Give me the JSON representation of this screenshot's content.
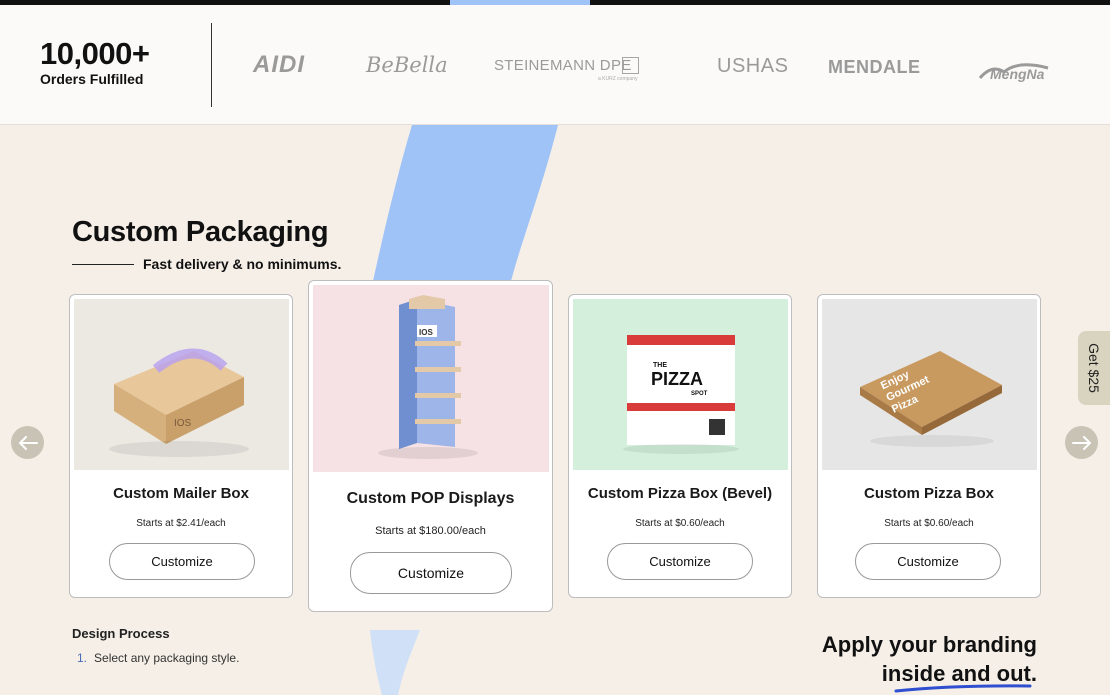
{
  "stats": {
    "number": "10,000+",
    "label": "Orders Fulfilled"
  },
  "brand_logos": [
    "AIDI",
    "BeBella",
    "STEINEMANN DPE",
    "USHAS",
    "MENDALE",
    "MengNa"
  ],
  "brand_logo_sub": "a KURZ company",
  "section": {
    "title": "Custom Packaging",
    "subtitle": "Fast delivery & no minimums."
  },
  "products": [
    {
      "name": "Custom Mailer Box",
      "price": "Starts at $2.41/each",
      "button": "Customize",
      "image_bg": "#ece8e2"
    },
    {
      "name": "Custom POP Displays",
      "price": "Starts at $180.00/each",
      "button": "Customize",
      "image_bg": "#f6e1e4"
    },
    {
      "name": "Custom Pizza Box (Bevel)",
      "price": "Starts at $0.60/each",
      "button": "Customize",
      "image_bg": "#d4f0dd"
    },
    {
      "name": "Custom Pizza Box",
      "price": "Starts at $0.60/each",
      "button": "Customize",
      "image_bg": "#e6e6e6"
    }
  ],
  "image_text": {
    "mailer_box": "IOS",
    "pop_display": "IOS",
    "pizza_line1": "THE",
    "pizza_line2": "PIZZA",
    "pizza_line3": "SPOT",
    "gourmet_line1": "Enjoy",
    "gourmet_line2": "Gourmet",
    "gourmet_line3": "Pizza"
  },
  "promo_tab": "Get $25",
  "process": {
    "title": "Design Process",
    "step_number": "1.",
    "step_text": "Select any packaging style."
  },
  "branding": {
    "line1": "Apply your branding",
    "line2": "inside and out."
  },
  "colors": {
    "accent_blue": "#9fc3f7",
    "background": "#f5efe8",
    "arrow_bg": "#c8c3b4",
    "promo_bg": "#d9d4c0"
  },
  "icons": {
    "arrow_left": "arrow-left-icon",
    "arrow_right": "arrow-right-icon"
  }
}
